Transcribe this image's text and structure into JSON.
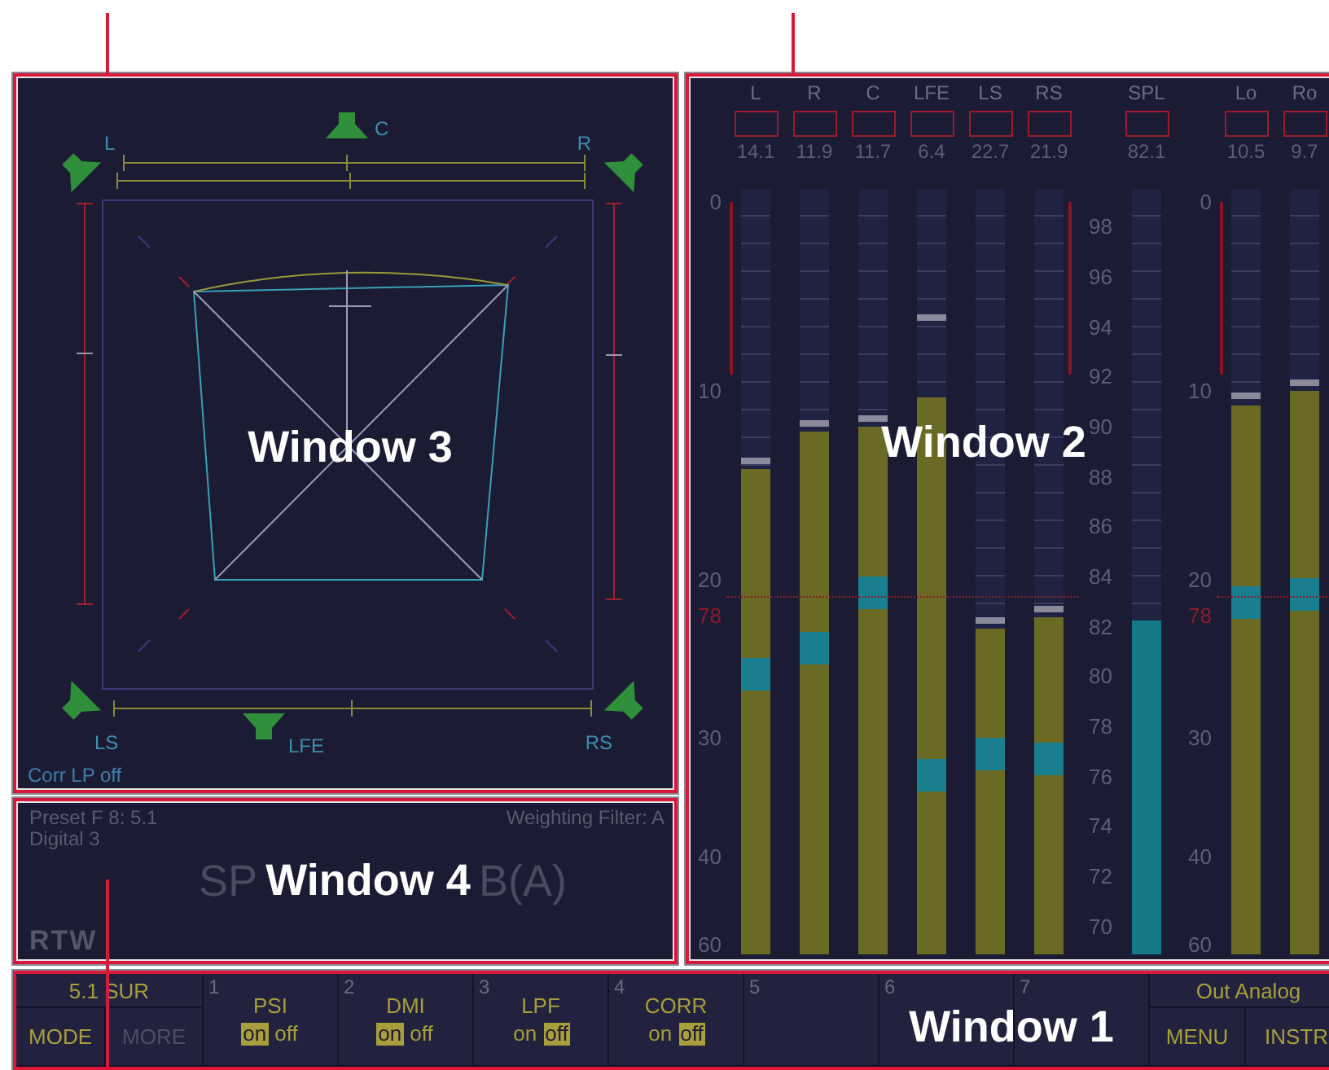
{
  "annotations": [
    {
      "text": "Window 3"
    },
    {
      "text": "Window 2"
    },
    {
      "text": "Window 4"
    },
    {
      "text": "Window 1"
    }
  ],
  "surround_scope": {
    "speakers": [
      {
        "label": "L"
      },
      {
        "label": "C"
      },
      {
        "label": "R"
      },
      {
        "label": "LS"
      },
      {
        "label": "LFE"
      },
      {
        "label": "RS"
      }
    ],
    "status": "Corr LP off"
  },
  "meters": {
    "groups": [
      {
        "kind": "db",
        "scale": [
          {
            "text": "0",
            "kind": "tick"
          },
          {
            "text": "10",
            "kind": "tick"
          },
          {
            "text": "20",
            "kind": "tick"
          },
          {
            "text": "78",
            "kind": "reference"
          },
          {
            "text": "30",
            "kind": "tick"
          },
          {
            "text": "40",
            "kind": "tick"
          },
          {
            "text": "60",
            "kind": "tick"
          }
        ],
        "channels": [
          {
            "name": "L",
            "reading": "14.1",
            "kind": "level",
            "bar": {
              "level": 0.634
            },
            "peak": {
              "level": 0.64
            },
            "marker": {
              "level": 0.366
            }
          },
          {
            "name": "R",
            "reading": "11.9",
            "kind": "level",
            "bar": {
              "level": 0.683
            },
            "peak": {
              "level": 0.69
            },
            "marker": {
              "level": 0.4
            }
          },
          {
            "name": "C",
            "reading": "11.7",
            "kind": "level",
            "bar": {
              "level": 0.69
            },
            "peak": {
              "level": 0.696
            },
            "marker": {
              "level": 0.472
            }
          },
          {
            "name": "LFE",
            "reading": "6.4",
            "kind": "level",
            "bar": {
              "level": 0.728
            },
            "peak": {
              "level": 0.828
            },
            "marker": {
              "level": 0.234
            }
          },
          {
            "name": "LS",
            "reading": "22.7",
            "kind": "level",
            "bar": {
              "level": 0.426
            },
            "peak": {
              "level": 0.432
            },
            "marker": {
              "level": 0.262
            }
          },
          {
            "name": "RS",
            "reading": "21.9",
            "kind": "level",
            "bar": {
              "level": 0.44
            },
            "peak": {
              "level": 0.446
            },
            "marker": {
              "level": 0.255
            }
          }
        ]
      },
      {
        "kind": "spl",
        "scale": [
          {
            "text": "98",
            "kind": "tick"
          },
          {
            "text": "96",
            "kind": "tick"
          },
          {
            "text": "94",
            "kind": "tick"
          },
          {
            "text": "92",
            "kind": "tick"
          },
          {
            "text": "90",
            "kind": "tick"
          },
          {
            "text": "88",
            "kind": "tick"
          },
          {
            "text": "86",
            "kind": "tick"
          },
          {
            "text": "84",
            "kind": "tick"
          },
          {
            "text": "82",
            "kind": "tick"
          },
          {
            "text": "80",
            "kind": "tick"
          },
          {
            "text": "78",
            "kind": "tick"
          },
          {
            "text": "76",
            "kind": "tick"
          },
          {
            "text": "74",
            "kind": "tick"
          },
          {
            "text": "72",
            "kind": "tick"
          },
          {
            "text": "70",
            "kind": "tick"
          }
        ],
        "channels": [
          {
            "name": "SPL",
            "reading": "82.1",
            "kind": "spl",
            "bar": {
              "level": 0.436
            }
          }
        ]
      },
      {
        "kind": "db",
        "scale": [
          {
            "text": "0",
            "kind": "tick"
          },
          {
            "text": "10",
            "kind": "tick"
          },
          {
            "text": "20",
            "kind": "tick"
          },
          {
            "text": "78",
            "kind": "reference"
          },
          {
            "text": "30",
            "kind": "tick"
          },
          {
            "text": "40",
            "kind": "tick"
          },
          {
            "text": "60",
            "kind": "tick"
          }
        ],
        "channels": [
          {
            "name": "Lo",
            "reading": "10.5",
            "kind": "level",
            "bar": {
              "level": 0.717
            },
            "peak": {
              "level": 0.725
            },
            "marker": {
              "level": 0.46
            }
          },
          {
            "name": "Ro",
            "reading": "9.7",
            "kind": "level",
            "bar": {
              "level": 0.736
            },
            "peak": {
              "level": 0.743
            },
            "marker": {
              "level": 0.47
            }
          }
        ]
      }
    ]
  },
  "info": {
    "preset": "Preset F 8: 5.1",
    "source": "Digital 3",
    "weighting": "Weighting Filter: A",
    "value_parts": [
      "SP",
      "B(A)"
    ],
    "logo": "RTW"
  },
  "softkeys": {
    "mode": {
      "title": "5.1 SUR",
      "buttons": [
        {
          "label": "MODE",
          "disabled": false
        },
        {
          "label": "MORE",
          "disabled": true
        }
      ]
    },
    "keys": [
      {
        "number": "1",
        "label": "PSI",
        "options": [
          {
            "text": "on",
            "selected": true
          },
          {
            "text": "off",
            "selected": false
          }
        ]
      },
      {
        "number": "2",
        "label": "DMI",
        "options": [
          {
            "text": "on",
            "selected": true
          },
          {
            "text": "off",
            "selected": false
          }
        ]
      },
      {
        "number": "3",
        "label": "LPF",
        "options": [
          {
            "text": "on",
            "selected": false
          },
          {
            "text": "off",
            "selected": true
          }
        ]
      },
      {
        "number": "4",
        "label": "CORR",
        "options": [
          {
            "text": "on",
            "selected": false
          },
          {
            "text": "off",
            "selected": true
          }
        ]
      },
      {
        "number": "5"
      },
      {
        "number": "6"
      },
      {
        "number": "7"
      }
    ],
    "menu": {
      "title": "Out Analog",
      "buttons": [
        {
          "label": "MENU",
          "disabled": false
        },
        {
          "label": "INSTR",
          "disabled": false
        }
      ]
    }
  }
}
